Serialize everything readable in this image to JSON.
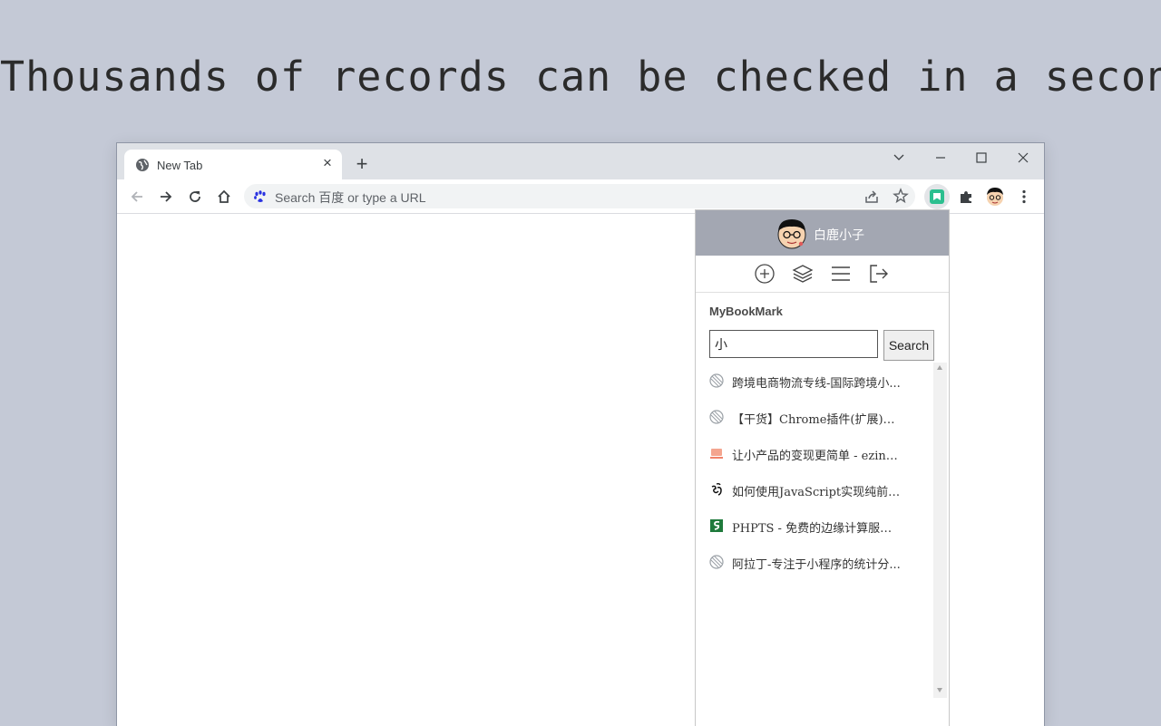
{
  "headline": "Thousands of records can be checked in a second",
  "browser": {
    "tab": {
      "title": "New Tab",
      "icon": "globe-icon",
      "close": "×"
    },
    "new_tab": "+",
    "window_controls": {
      "tab_search": "chevron-down-icon",
      "minimize": "minimize-icon",
      "maximize": "maximize-icon",
      "close": "close-icon"
    },
    "omnibox": {
      "placeholder": "Search 百度 or type a URL",
      "search_engine_icon": "baidu-paw-icon"
    },
    "toolbar_icons": [
      "back-icon",
      "forward-icon",
      "reload-icon",
      "home-icon",
      "share-icon",
      "star-icon",
      "bookmark-extension-icon",
      "puzzle-icon",
      "profile-avatar-icon",
      "kebab-menu-icon"
    ]
  },
  "popup": {
    "username": "白鹿小子",
    "actions": [
      "add-icon",
      "layers-icon",
      "menu-icon",
      "logout-icon"
    ],
    "title": "MyBookMark",
    "search": {
      "value": "小",
      "button": "Search"
    },
    "results": [
      {
        "title": "跨境电商物流专线-国际跨境小...",
        "icon": "globe-icon"
      },
      {
        "title": "【干货】Chrome插件(扩展)开...",
        "icon": "globe-icon"
      },
      {
        "title": "让小产品的变现更简单 - ezindi...",
        "icon": "laptop-icon"
      },
      {
        "title": "如何使用JavaScript实现纯前端...",
        "icon": "om-icon"
      },
      {
        "title": "PHPTS - 免费的边缘计算服务...",
        "icon": "phpts-logo-icon"
      },
      {
        "title": "阿拉丁-专注于小程序的统计分...",
        "icon": "globe-icon"
      }
    ]
  },
  "colors": {
    "page_bg": "#c4c9d6",
    "popup_header": "#a3a7b2",
    "tabstrip": "#dee1e6"
  }
}
